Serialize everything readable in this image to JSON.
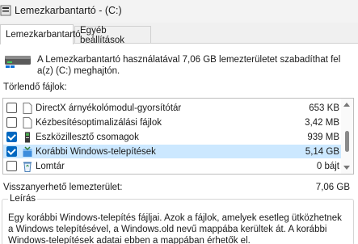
{
  "window": {
    "title": "Lemezkarbantartó  -  (C:)"
  },
  "tabs": [
    {
      "label": "Lemezkarbantartó"
    },
    {
      "label": "Egyéb beállítások"
    }
  ],
  "info": {
    "text": "A Lemezkarbantartó használatával 7,06 GB lemezterületet szabadíthat fel a(z)  (C:) meghajtón."
  },
  "files": {
    "label": "Törlendő fájlok:",
    "items": [
      {
        "name": "DirectX árnyékolómodul-gyorsítótár",
        "size": "653 KB",
        "checked": false,
        "icon": "file-icon"
      },
      {
        "name": "Kézbesítésoptimalizálási fájlok",
        "size": "3,42 MB",
        "checked": false,
        "icon": "file-icon"
      },
      {
        "name": "Eszközillesztő csomagok",
        "size": "939 MB",
        "checked": true,
        "icon": "driver-package-icon"
      },
      {
        "name": "Korábbi Windows-telepítések",
        "size": "5,14 GB",
        "checked": true,
        "icon": "windows-install-icon"
      },
      {
        "name": "Lomtár",
        "size": "0 bájt",
        "checked": false,
        "icon": "recycle-bin-icon"
      }
    ]
  },
  "total": {
    "label": "Visszanyerhető lemezterület:",
    "value": "7,06 GB"
  },
  "description": {
    "legend": "Leírás",
    "text": "Egy korábbi Windows-telepítés fájljai. Azok a fájlok, amelyek esetleg ütközhetnek a Windows telepítésével, a Windows.old nevű mappába kerültek át. A korábbi Windows-telepítések adatai ebben a mappában érhetők el."
  },
  "colors": {
    "selection": "#cce8ff",
    "accent": "#0067c0"
  }
}
